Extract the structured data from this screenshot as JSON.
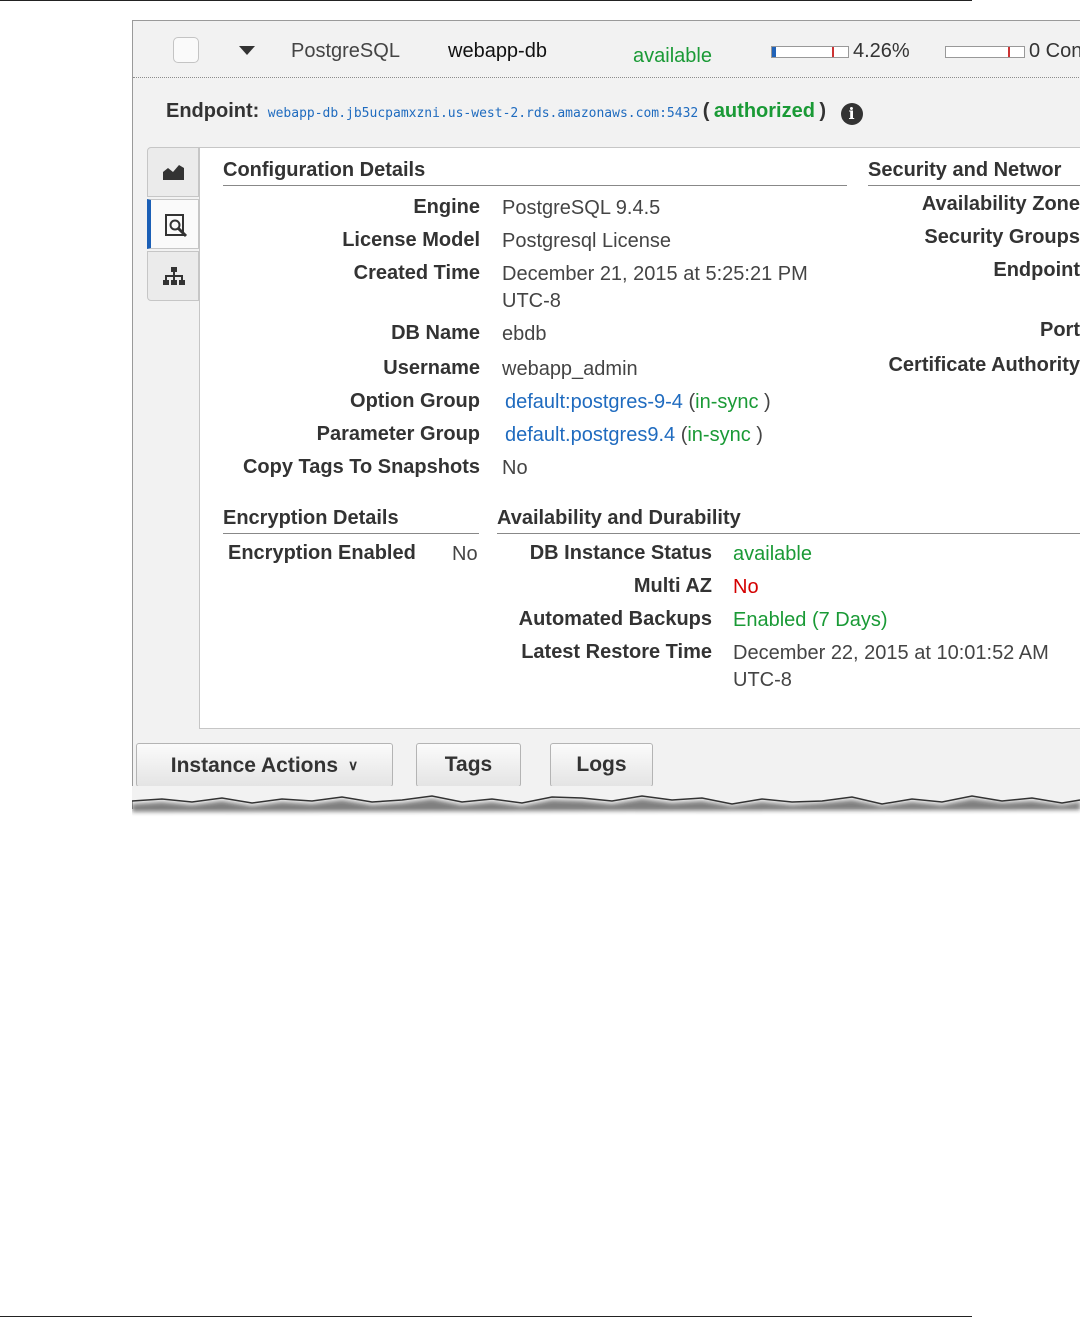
{
  "instance_row": {
    "engine": "PostgreSQL",
    "db_identifier": "webapp-db",
    "status": "available",
    "cpu": "4.26%",
    "cpu_fraction": 0.05,
    "connections": "0 Con",
    "connections_fraction": 0.0
  },
  "endpoint": {
    "label": "Endpoint:",
    "value": "webapp-db.jb5ucpamxzni.us-west-2.rds.amazonaws.com:5432",
    "open_paren": "(",
    "status": "authorized",
    "close_paren": ")",
    "icon": "info-icon"
  },
  "tabs": [
    {
      "icon": "monitoring-chart-icon"
    },
    {
      "icon": "details-magnifier-icon",
      "active": true
    },
    {
      "icon": "hierarchy-icon"
    }
  ],
  "configuration": {
    "title": "Configuration Details",
    "engine_label": "Engine",
    "engine": "PostgreSQL 9.4.5",
    "license_label": "License Model",
    "license": "Postgresql License",
    "created_label": "Created Time",
    "created_line1": "December 21, 2015 at 5:25:21 PM",
    "created_line2": "UTC-8",
    "dbname_label": "DB Name",
    "dbname": "ebdb",
    "username_label": "Username",
    "username": "webapp_admin",
    "option_group_label": "Option Group",
    "option_group": "default:postgres-9-4",
    "option_group_status": "in-sync",
    "parameter_group_label": "Parameter Group",
    "parameter_group": "default.postgres9.4",
    "parameter_group_status": "in-sync",
    "copy_tags_label": "Copy Tags To Snapshots",
    "copy_tags": "No",
    "paren_open": "(",
    "paren_close": ")"
  },
  "security": {
    "title": "Security and Networ",
    "az_label": "Availability Zone",
    "sg_label": "Security Groups",
    "endpoint_label": "Endpoint",
    "port_label": "Port",
    "ca_label": "Certificate Authority"
  },
  "encryption": {
    "title": "Encryption Details",
    "enabled_label": "Encryption Enabled",
    "enabled": "No"
  },
  "availability": {
    "title": "Availability and Durability",
    "status_label": "DB Instance Status",
    "status": "available",
    "multiaz_label": "Multi AZ",
    "multiaz": "No",
    "backups_label": "Automated Backups",
    "backups": "Enabled (7 Days)",
    "restore_label": "Latest Restore Time",
    "restore_line1": "December 22, 2015 at 10:01:52 AM",
    "restore_line2": "UTC-8"
  },
  "buttons": {
    "instance_actions": "Instance Actions",
    "tags": "Tags",
    "logs": "Logs"
  },
  "colors": {
    "status_green": "#1a9a36",
    "link_blue": "#1f6bbf",
    "alert_red": "#d40000",
    "active_tab": "#1b5fb6"
  }
}
